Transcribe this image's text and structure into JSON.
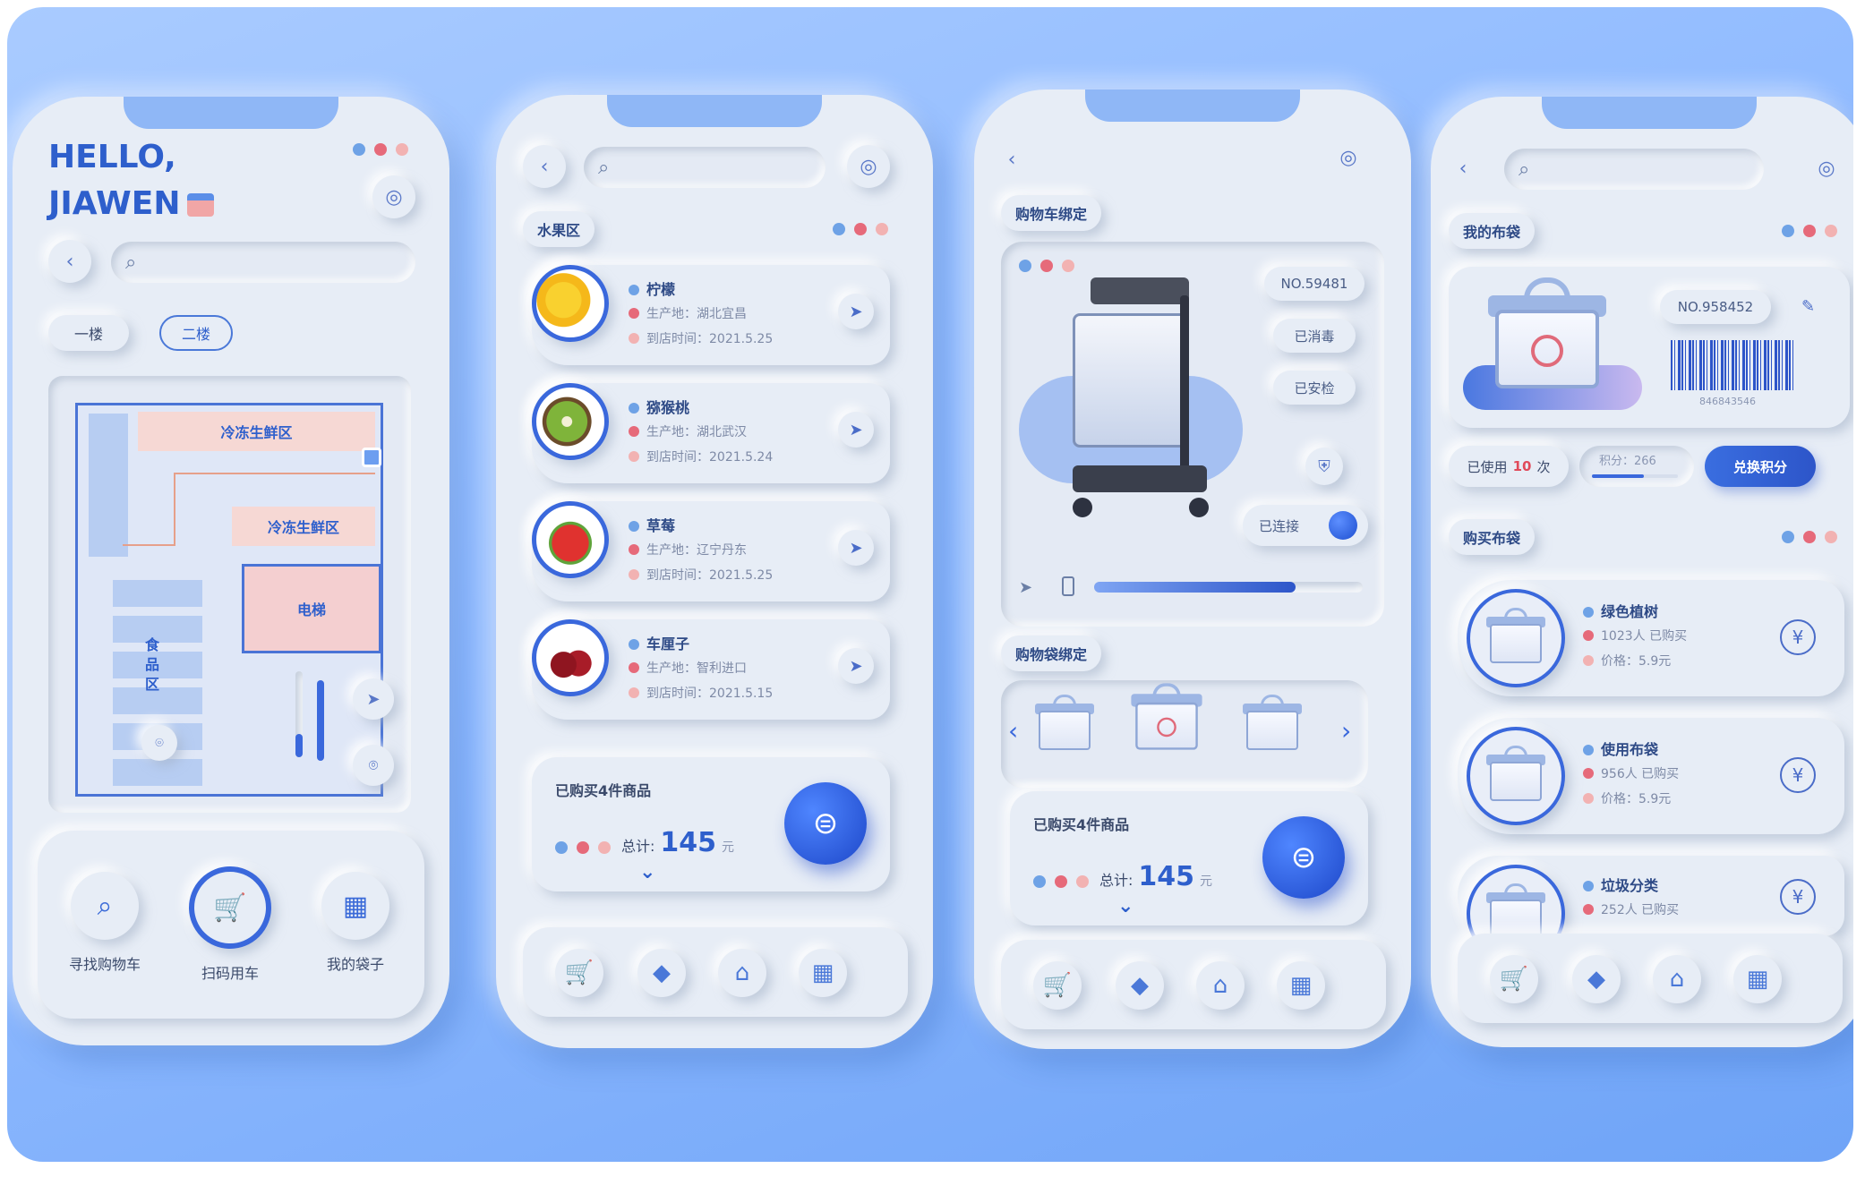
{
  "phone1": {
    "greeting_line1": "HELLO,",
    "greeting_line2": "JIAWEN",
    "floors": [
      "一楼",
      "二楼"
    ],
    "map": {
      "zone_top": "冷冻生鲜区",
      "zone_mid": "冷冻生鲜区",
      "elevator": "电梯",
      "food_zone": [
        "食",
        "品",
        "区"
      ]
    },
    "nav": [
      "寻找购物车",
      "扫码用车",
      "我的袋子"
    ]
  },
  "phone2": {
    "section": "水果区",
    "fruits": [
      {
        "name": "柠檬",
        "origin": "生产地：湖北宜昌",
        "date": "到店时间：2021.5.25"
      },
      {
        "name": "猕猴桃",
        "origin": "生产地：湖北武汉",
        "date": "到店时间：2021.5.24"
      },
      {
        "name": "草莓",
        "origin": "生产地：辽宁丹东",
        "date": "到店时间：2021.5.25"
      },
      {
        "name": "车厘子",
        "origin": "生产地：智利进口",
        "date": "到店时间：2021.5.15"
      }
    ],
    "summary": {
      "title": "已购买4件商品",
      "total_label": "总计:",
      "total": "145",
      "unit": "元"
    }
  },
  "phone3": {
    "section_cart": "购物车绑定",
    "cart_no": "NO.59481",
    "badge1": "已消毒",
    "badge2": "已安检",
    "connected": "已连接",
    "battery_level": 0.75,
    "section_bag": "购物袋绑定",
    "summary": {
      "title": "已购买4件商品",
      "total_label": "总计:",
      "total": "145",
      "unit": "元"
    }
  },
  "phone4": {
    "section_mybag": "我的布袋",
    "bag_no": "NO.958452",
    "barcode_number": "846843546",
    "used_label": "已使用",
    "used_count": "10",
    "used_unit": "次",
    "points_label": "积分：266",
    "points_progress": 0.6,
    "redeem": "兑换积分",
    "section_buy": "购买布袋",
    "bags": [
      {
        "name": "绿色植树",
        "buyers": "1023人 已购买",
        "price": "价格：5.9元"
      },
      {
        "name": "使用布袋",
        "buyers": "956人 已购买",
        "price": "价格：5.9元"
      },
      {
        "name": "垃圾分类",
        "buyers": "252人 已购买"
      }
    ]
  },
  "icons": {
    "back": "‹",
    "search": "⌕",
    "settings": "◎",
    "send": "➤",
    "pin": "⌾",
    "yuan": "¥",
    "pay": "⊜",
    "chevron": "⌄"
  },
  "colors": {
    "accent": "#2e5fcc",
    "bg": "#8fbaff",
    "card": "#e7edf6",
    "red": "#e66a7a"
  }
}
